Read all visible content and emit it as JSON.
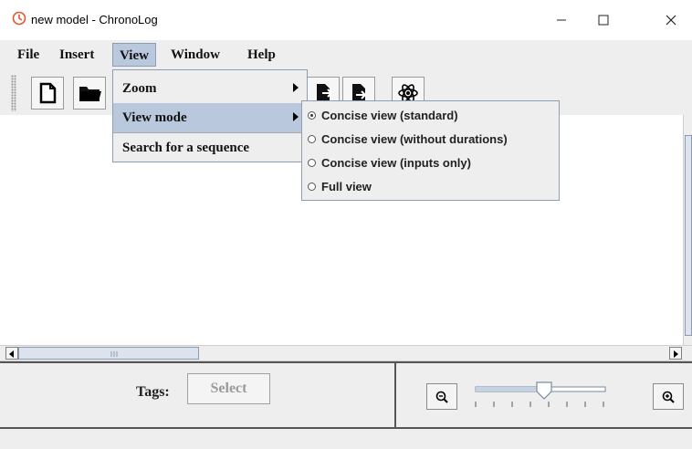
{
  "window": {
    "title": "new model - ChronoLog",
    "min_icon": "minimize-icon",
    "max_icon": "maximize-icon",
    "close_icon": "close-icon"
  },
  "menubar": {
    "items": [
      "File",
      "Insert",
      "View",
      "Window",
      "Help"
    ]
  },
  "toolbar": {
    "buttons": [
      "new-file-icon",
      "open-folder-icon",
      "export-icon",
      "import-icon",
      "atom-icon"
    ]
  },
  "view_menu": {
    "items": [
      "Zoom",
      "View mode",
      "Search for a sequence"
    ]
  },
  "view_mode_submenu": {
    "options": [
      "Concise view (standard)",
      "Concise view (without durations)",
      "Concise view (inputs only)",
      "Full view"
    ],
    "selected": "Concise view (standard)"
  },
  "bottom_panel": {
    "tags_label": "Tags:",
    "select_button": "Select",
    "zoom_out_icon": "zoom-out-icon",
    "zoom_in_icon": "zoom-in-icon",
    "zoom_slider_position": 0.5
  },
  "colors": {
    "menu_highlight": "#b9c8dc",
    "background": "#eeeeee",
    "app_icon": "#e0552e"
  }
}
